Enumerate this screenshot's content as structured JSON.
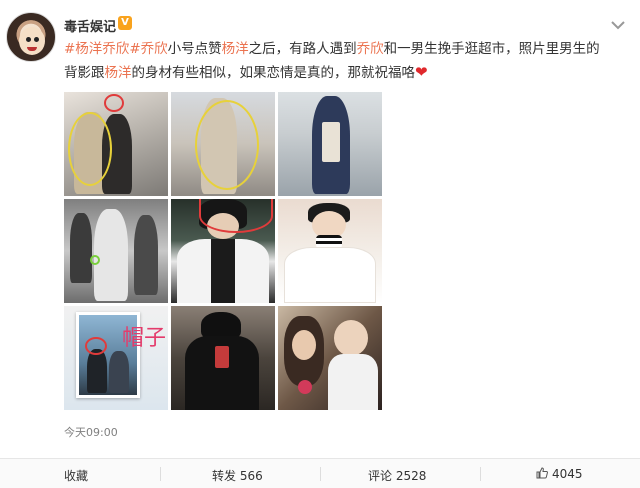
{
  "post": {
    "user_name": "毒舌娱记",
    "verified_badge": "V",
    "more_icon": "chevron-down-icon",
    "text_segments": [
      {
        "t": "#杨洋乔欣",
        "tag": true
      },
      {
        "t": "#乔欣",
        "tag": true
      },
      {
        "t": "小号点赞",
        "tag": false
      },
      {
        "t": "杨洋",
        "tag": true
      },
      {
        "t": "之后，有路人遇到",
        "tag": false
      },
      {
        "t": "乔欣",
        "tag": true
      },
      {
        "t": "和一男生挽手逛超市，照片里男生的背影跟",
        "tag": false
      },
      {
        "t": "杨洋",
        "tag": true
      },
      {
        "t": "的身材有些相似，如果恋情是真的，那就祝福咯",
        "tag": false
      }
    ],
    "heart_icon": "heart-icon",
    "photo_overlay_text": "帽子",
    "timestamp": "今天09:00"
  },
  "footer": {
    "collect_label": "收藏",
    "repost_label": "转发 566",
    "comment_label": "评论 2528",
    "like_count": "4045",
    "like_icon": "thumbs-up-icon"
  },
  "colors": {
    "tag": "#eb7350",
    "heart": "#e0282c",
    "badge": "#f9a31d"
  }
}
